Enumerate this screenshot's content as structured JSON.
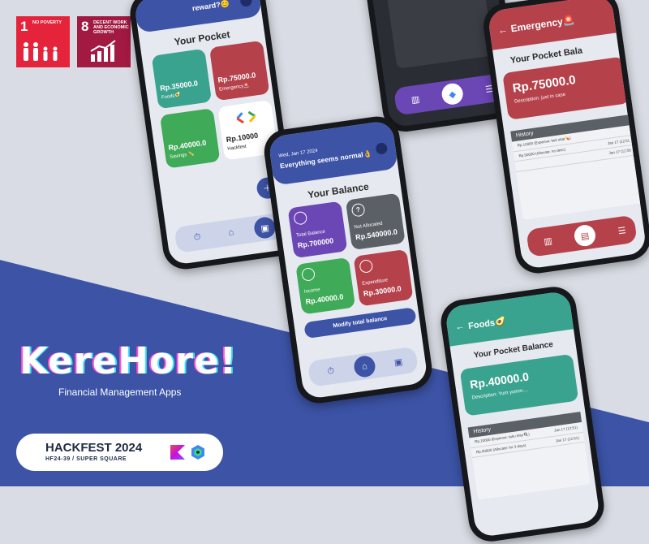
{
  "branding": {
    "app_name": "KereHore!",
    "tagline": "Financial Management Apps",
    "event_title": "HACKFEST 2024",
    "event_sub": "HF24-39 / SUPER SQUARE"
  },
  "sdg_badges": [
    {
      "number": "1",
      "text": "NO POVERTY",
      "color": "#e5243b"
    },
    {
      "number": "8",
      "text": "DECENT WORK AND ECONOMIC GROWTH",
      "color": "#a21942"
    }
  ],
  "colors": {
    "primary_blue": "#3c53a6",
    "background": "#d9dce4",
    "foods_teal": "#3aa38f",
    "emergency_red": "#b5414b",
    "savings_green": "#3faa57",
    "total_purple": "#6b46b5",
    "gray_card": "#5b5f66"
  },
  "phone_pocket": {
    "header": "reward?😊",
    "title": "Your Pocket",
    "cards": [
      {
        "amount": "Rp.35000.0",
        "label": "Foods🥑"
      },
      {
        "amount": "Rp.75000.0",
        "label": "Emergency🚨"
      },
      {
        "amount": "Rp.40000.0",
        "label": "Savings ✏️"
      },
      {
        "amount": "Rp.10000",
        "label": "Hackfest"
      }
    ]
  },
  "phone_balance": {
    "date": "Wed, Jan 17 2024",
    "status": "Everything seems normal👌",
    "title": "Your Balance",
    "cards": [
      {
        "label": "Total Balance",
        "amount": "Rp.700000"
      },
      {
        "label": "Not Allocated",
        "amount": "Rp.540000.0"
      },
      {
        "label": "Income",
        "amount": "Rp.40000.0"
      },
      {
        "label": "Expenditure",
        "amount": "Rp.30000.0"
      }
    ],
    "modify_button": "Modify total balance"
  },
  "phone_emergency": {
    "header": "Emergency🚨",
    "title": "Your Pocket Bala",
    "amount": "Rp.75000.0",
    "description": "Description: just in case",
    "history_title": "History",
    "history": [
      {
        "text": "Rp.10000 (Expense: beli obat💊)",
        "date": ""
      },
      {
        "text": "Rp.50000 (Allocate: no desc)",
        "date": "Jan 17 (12:51"
      },
      {
        "text": "",
        "date": "Jan 17 (12:50"
      }
    ]
  },
  "phone_foods": {
    "header": "Foods🥑",
    "title": "Your Pocket Balance",
    "amount": "Rp.40000.0",
    "description": "Description: Yum yumm....",
    "history_title": "History",
    "history": [
      {
        "text": "Rp.10000 (Expense: tahu telur🍳)",
        "date": "Jan 17 (12:51)"
      },
      {
        "text": "Rp.50000 (Allocate: for 3 days)",
        "date": "Jan 17 (12:51)"
      }
    ]
  }
}
